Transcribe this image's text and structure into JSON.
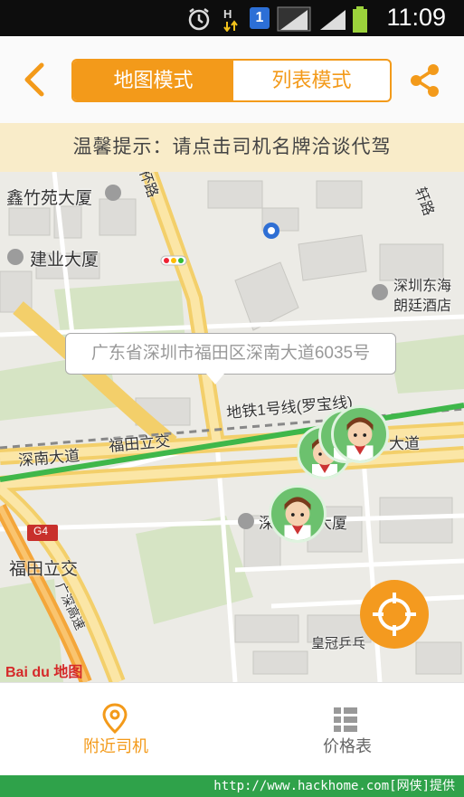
{
  "status_bar": {
    "time": "11:09",
    "sim_badge": "1",
    "battery_color": "#9bd23b"
  },
  "header": {
    "back_icon": "chevron-left-icon",
    "tabs": [
      {
        "label": "地图模式",
        "active": true
      },
      {
        "label": "列表模式",
        "active": false
      }
    ],
    "share_icon": "share-icon",
    "accent": "#f39a1a"
  },
  "tip": {
    "text": "温馨提示：请点击司机名牌洽谈代驾"
  },
  "map": {
    "callout": "广东省深圳市福田区深南大道6035号",
    "labels": {
      "l1": "鑫竹苑大厦",
      "l2": "建业大厦",
      "l3": "深圳东海",
      "l4": "朗廷酒店",
      "l5": "地铁1号线(罗宝线)",
      "l6": "深南大道",
      "l7": "福田立交",
      "l8": "大道",
      "l9": "福田立交",
      "l10": "G4",
      "l11": "广深高速",
      "l12": "皇冠乒乓",
      "l13": "杯路",
      "l14": "轩路",
      "l15": "大厦",
      "l16": "深"
    },
    "brand": "Bai du 地图",
    "locate_icon": "locate-crosshair-icon"
  },
  "tabbar": {
    "items": [
      {
        "label": "附近司机",
        "icon": "location-pin-icon",
        "active": true
      },
      {
        "label": "价格表",
        "icon": "list-icon",
        "active": false
      }
    ]
  },
  "footer": {
    "text": "http://www.hackhome.com[网侠]提供"
  }
}
